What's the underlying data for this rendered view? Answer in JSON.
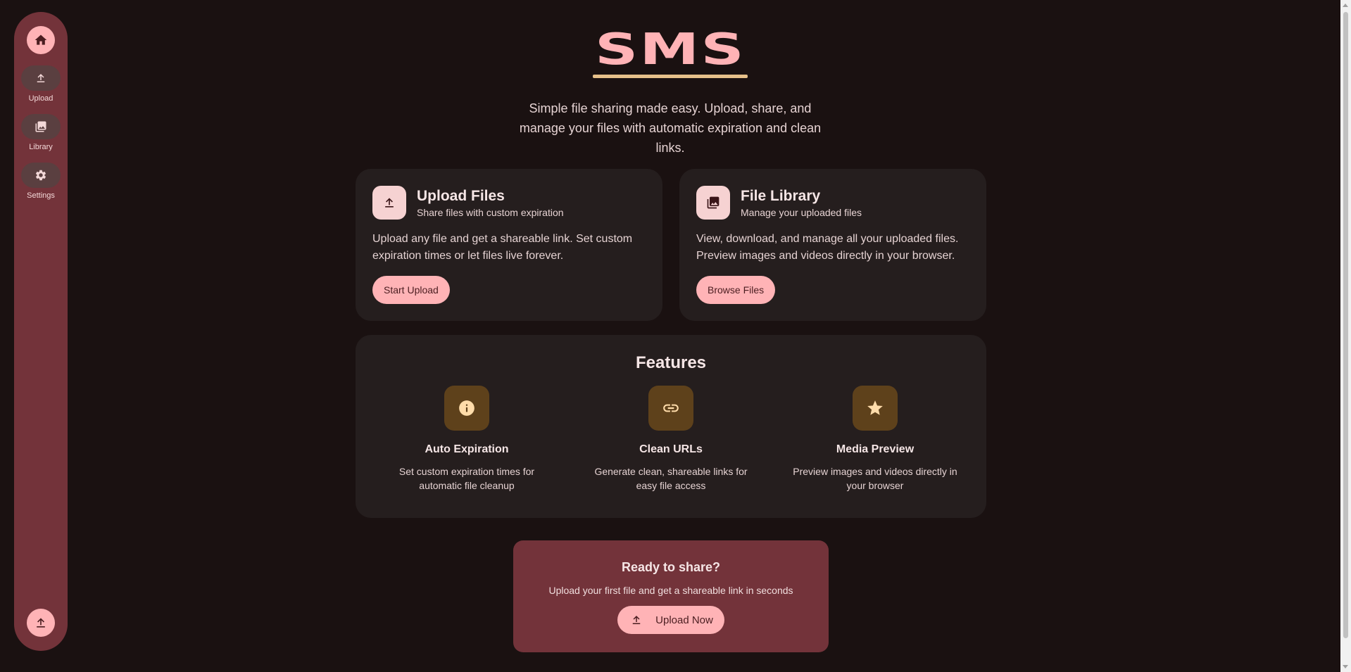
{
  "colors": {
    "background": "#1a1111",
    "rail": "#73333a",
    "accent_pink": "#ffb3b6",
    "card": "#251e1e",
    "feature_icon_bg": "#5e411b",
    "logo_underline": "#e6c08a"
  },
  "nav": {
    "home_icon": "home-icon",
    "items": [
      {
        "label": "Upload",
        "icon": "upload-icon"
      },
      {
        "label": "Library",
        "icon": "photo-library-icon"
      },
      {
        "label": "Settings",
        "icon": "gear-icon"
      }
    ],
    "fab_icon": "upload-icon"
  },
  "hero": {
    "logo": "SMS",
    "tagline": "Simple file sharing made easy. Upload, share, and manage your files with automatic expiration and clean links."
  },
  "cards": {
    "upload": {
      "icon": "upload-icon",
      "title": "Upload Files",
      "subtitle": "Share files with custom expiration",
      "description": "Upload any file and get a shareable link. Set custom expiration times or let files live forever.",
      "button": "Start Upload"
    },
    "library": {
      "icon": "photo-library-icon",
      "title": "File Library",
      "subtitle": "Manage your uploaded files",
      "description": "View, download, and manage all your uploaded files. Preview images and videos directly in your browser.",
      "button": "Browse Files"
    }
  },
  "features": {
    "title": "Features",
    "items": [
      {
        "icon": "info-icon",
        "title": "Auto Expiration",
        "description": "Set custom expiration times for automatic file cleanup"
      },
      {
        "icon": "link-icon",
        "title": "Clean URLs",
        "description": "Generate clean, shareable links for easy file access"
      },
      {
        "icon": "star-icon",
        "title": "Media Preview",
        "description": "Preview images and videos directly in your browser"
      }
    ]
  },
  "cta": {
    "title": "Ready to share?",
    "subtitle": "Upload your first file and get a shareable link in seconds",
    "button": "Upload Now",
    "button_icon": "upload-icon"
  }
}
